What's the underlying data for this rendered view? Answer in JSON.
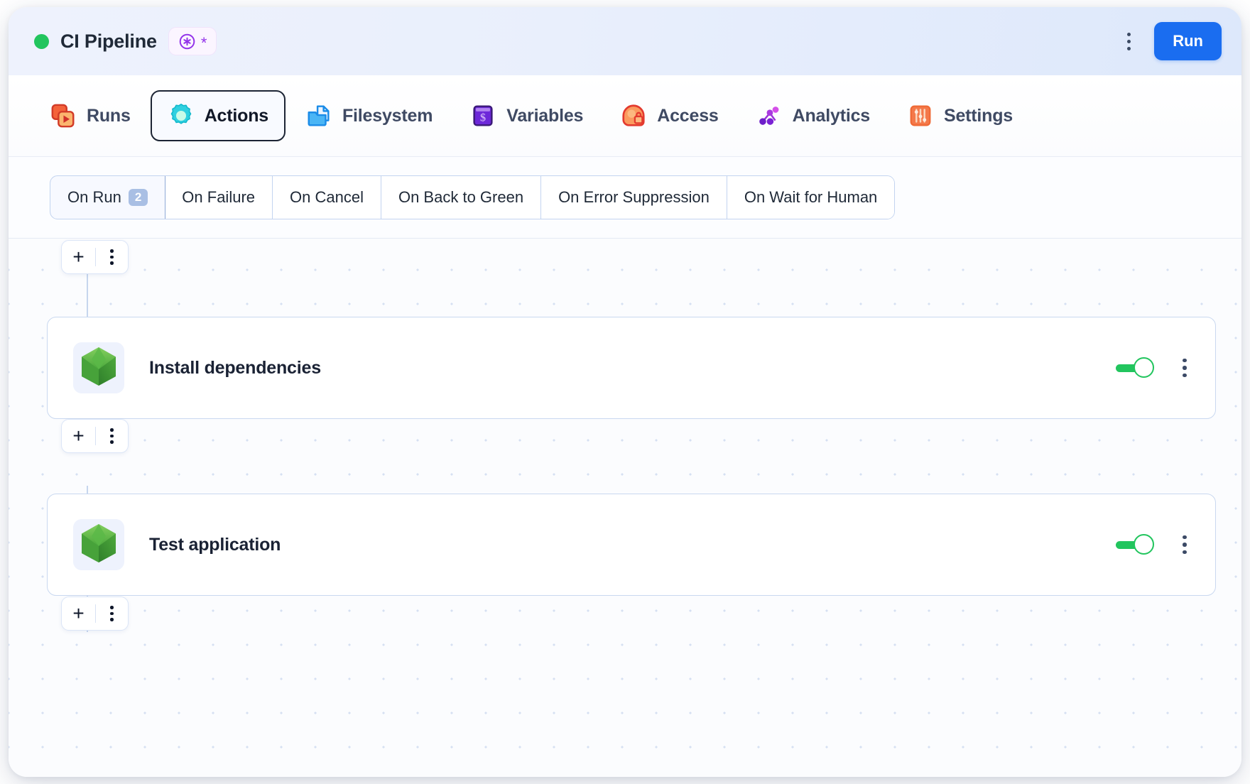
{
  "window": {
    "title": "CI Pipeline",
    "status_color": "#22c55e",
    "badge": {
      "icon": "asterisk-circle-icon",
      "symbol": "*",
      "accent": "#9333ea"
    },
    "menu_icon": "kebab-menu-icon",
    "run_label": "Run",
    "run_color": "#1a6df0"
  },
  "nav": {
    "items": [
      {
        "label": "Runs",
        "icon": "runs-icon",
        "active": false
      },
      {
        "label": "Actions",
        "icon": "actions-gear-icon",
        "active": true
      },
      {
        "label": "Filesystem",
        "icon": "filesystem-icon",
        "active": false
      },
      {
        "label": "Variables",
        "icon": "variables-icon",
        "active": false
      },
      {
        "label": "Access",
        "icon": "access-lock-icon",
        "active": false
      },
      {
        "label": "Analytics",
        "icon": "analytics-icon",
        "active": false
      },
      {
        "label": "Settings",
        "icon": "settings-sliders-icon",
        "active": false
      }
    ]
  },
  "subtabs": {
    "items": [
      {
        "label": "On Run",
        "count": "2",
        "active": true
      },
      {
        "label": "On Failure",
        "count": "",
        "active": false
      },
      {
        "label": "On Cancel",
        "count": "",
        "active": false
      },
      {
        "label": "On Back to Green",
        "count": "",
        "active": false
      },
      {
        "label": "On Error Suppression",
        "count": "",
        "active": false
      },
      {
        "label": "On Wait for Human",
        "count": "",
        "active": false
      }
    ]
  },
  "canvas": {
    "add_buttons": [
      {
        "plus": "+",
        "menu_icon": "kebab-menu-icon"
      },
      {
        "plus": "+",
        "menu_icon": "kebab-menu-icon"
      },
      {
        "plus": "+",
        "menu_icon": "kebab-menu-icon"
      }
    ],
    "nodes": [
      {
        "title": "Install dependencies",
        "icon": "nodejs-hexagon-icon",
        "enabled": true,
        "toggle_color": "#22c55e",
        "menu_icon": "kebab-menu-icon"
      },
      {
        "title": "Test application",
        "icon": "nodejs-hexagon-icon",
        "enabled": true,
        "toggle_color": "#22c55e",
        "menu_icon": "kebab-menu-icon"
      }
    ]
  }
}
